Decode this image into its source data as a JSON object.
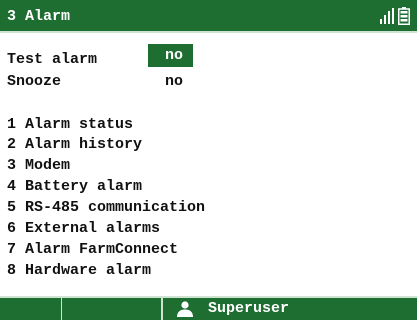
{
  "header": {
    "title": "3 Alarm",
    "signal_icon": "signal-bars-icon",
    "battery_icon": "battery-icon"
  },
  "settings": {
    "test_alarm": {
      "label": "Test alarm",
      "value": "no"
    },
    "snooze": {
      "label": "Snooze",
      "value": "no"
    }
  },
  "menu": {
    "items": [
      {
        "label": "1 Alarm status"
      },
      {
        "label": "2 Alarm history"
      },
      {
        "label": "3 Modem"
      },
      {
        "label": "4 Battery alarm"
      },
      {
        "label": "5 RS-485 communication"
      },
      {
        "label": "6 External alarms"
      },
      {
        "label": "7 Alarm FarmConnect"
      },
      {
        "label": "8 Hardware alarm"
      }
    ]
  },
  "footer": {
    "user_icon": "user-icon",
    "user_label": "Superuser"
  },
  "colors": {
    "accent": "#1e6e32",
    "text": "#111111",
    "background": "#ffffff"
  }
}
